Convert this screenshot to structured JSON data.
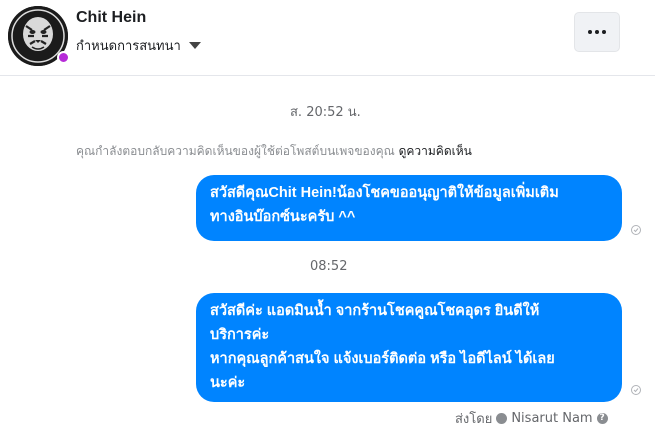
{
  "header": {
    "name": "Chit Hein",
    "subtitle": "กำหนดการสนทนา",
    "more_icon": "more-dots-icon"
  },
  "conversation": {
    "timestamp1": "ส. 20:52 น.",
    "notice_text": "คุณกำลังตอบกลับความคิดเห็นของผู้ใช้ต่อโพสต์บนเพจของคุณ",
    "notice_link": "ดูความคิดเห็น",
    "message1": "สวัสดีคุณChit Hein!น้องโชคขออนุญาติให้ข้อมูลเพิ่มเติม\nทางอินบ๊อกซ์นะครับ ^^",
    "timestamp2": "08:52",
    "message2": "สวัสดีค่ะ แอดมินน้ำ จากร้านโชคคูณโชคอุดร ยินดีให้\nบริการค่ะ\nหากคุณลูกค้าสนใจ แจ้งเบอร์ติดต่อ หรือ ไอดีไลน์ ได้เลย\nนะค่ะ",
    "sent_by_label": "ส่งโดย",
    "sent_by_name": "Nisarut Nam"
  },
  "colors": {
    "bubble": "#0084ff",
    "badge": "#b62bd8"
  }
}
